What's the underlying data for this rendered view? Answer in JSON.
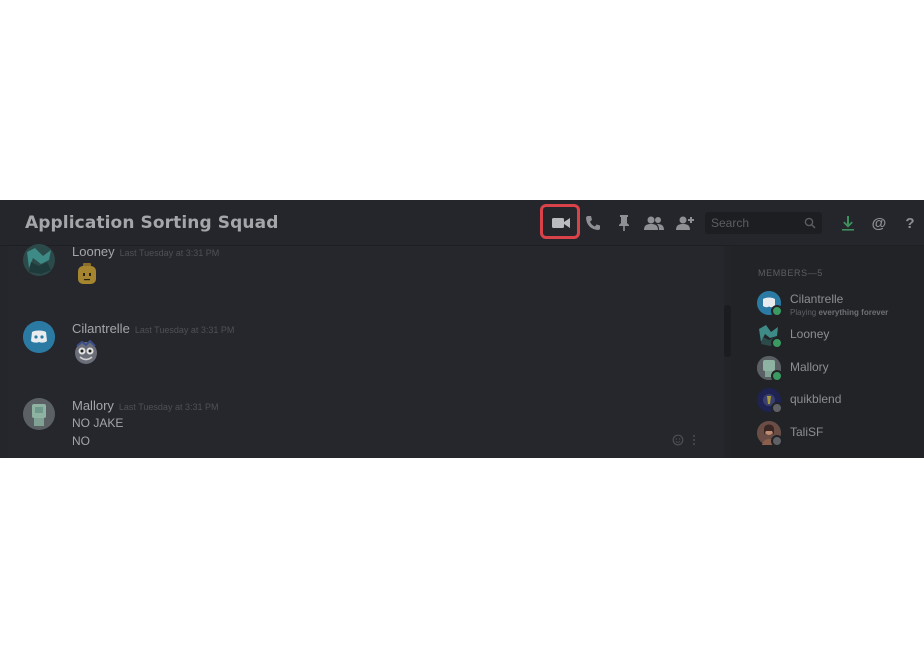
{
  "header": {
    "channel_title": "Application Sorting Squad",
    "icons": [
      "video-call-icon",
      "voice-call-icon",
      "pin-icon",
      "members-icon",
      "add-friend-icon"
    ],
    "search_placeholder": "Search",
    "right_icons": [
      "download-icon",
      "mention-icon",
      "help-icon"
    ],
    "highlight_color": "#d94249"
  },
  "messages": [
    {
      "author": "Looney",
      "timestamp": "Last Tuesday at 3:31 PM",
      "content": "lego-emoji"
    },
    {
      "author": "Cilantrelle",
      "timestamp": "Last Tuesday at 3:31 PM",
      "content": "cartoon-emoji"
    },
    {
      "author": "Mallory",
      "timestamp": "Last Tuesday at 3:31 PM",
      "lines": [
        "NO JAKE",
        "NO"
      ]
    }
  ],
  "members": {
    "header": "MEMBERS—5",
    "list": [
      {
        "name": "Cilantrelle",
        "activity_prefix": "Playing ",
        "activity_game": "everything forever",
        "status": "online"
      },
      {
        "name": "Looney",
        "status": "online"
      },
      {
        "name": "Mallory",
        "status": "online"
      },
      {
        "name": "quikblend",
        "status": "offline"
      },
      {
        "name": "TaliSF",
        "status": "offline"
      }
    ]
  }
}
